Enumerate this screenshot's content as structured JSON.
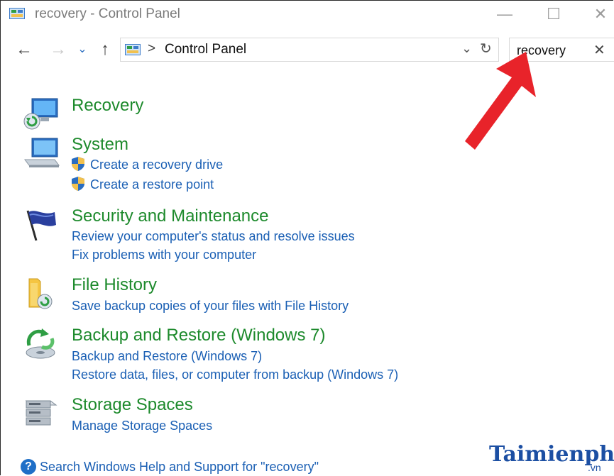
{
  "window": {
    "title": "recovery - Control Panel",
    "minimize_glyph": "—",
    "maximize_glyph": "☐",
    "close_glyph": "✕"
  },
  "nav": {
    "back_glyph": "←",
    "forward_glyph": "→",
    "recent_glyph": "⌄",
    "up_glyph": "↑",
    "breadcrumb_sep": ">",
    "address": "Control Panel",
    "dropdown_glyph": "⌄",
    "refresh_glyph": "↻"
  },
  "search": {
    "value": "recovery",
    "clear_glyph": "✕"
  },
  "results": [
    {
      "title": "Recovery",
      "icon": "recovery-icon",
      "links": []
    },
    {
      "title": "System",
      "icon": "system-icon",
      "links": [
        "Create a recovery drive",
        "Create a restore point"
      ]
    },
    {
      "title": "Security and Maintenance",
      "icon": "flag-icon",
      "links": [
        "Review your computer's status and resolve issues",
        "Fix problems with your computer"
      ]
    },
    {
      "title": "File History",
      "icon": "file-history-icon",
      "links": [
        "Save backup copies of your files with File History"
      ]
    },
    {
      "title": "Backup and Restore (Windows 7)",
      "icon": "backup-icon",
      "links": [
        "Backup and Restore (Windows 7)",
        "Restore data, files, or computer from backup (Windows 7)"
      ]
    },
    {
      "title": "Storage Spaces",
      "icon": "storage-icon",
      "links": [
        "Manage Storage Spaces"
      ]
    }
  ],
  "footer": {
    "help_glyph": "?",
    "help_link": "Search Windows Help and Support for \"recovery\""
  },
  "watermark": {
    "text": "Taimienphi",
    "sub": ".vn"
  },
  "colors": {
    "title_green": "#1d8a2c",
    "link_blue": "#1a5fb4",
    "arrow_red": "#e8232a"
  }
}
